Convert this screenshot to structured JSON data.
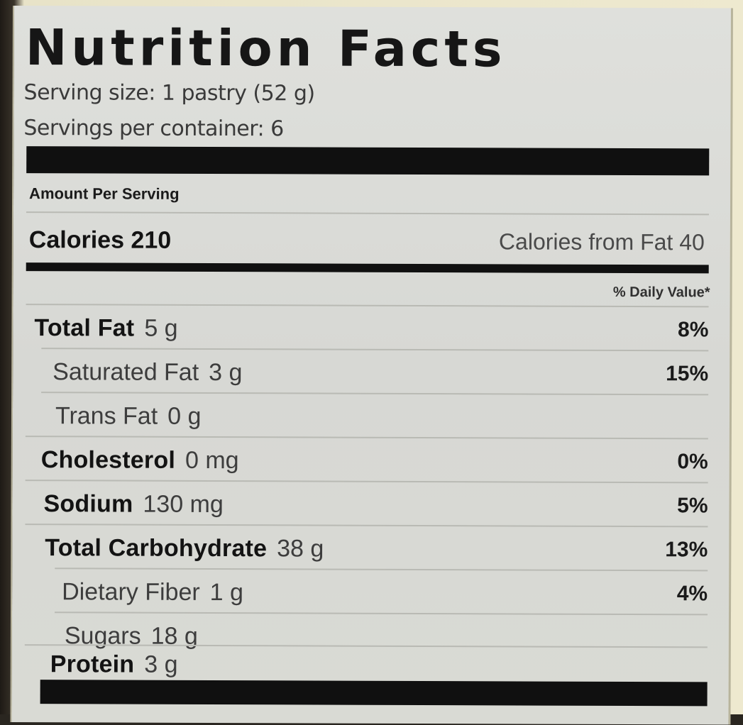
{
  "label": {
    "title": "Nutrition Facts",
    "serving_size": "Serving size: 1 pastry (52 g)",
    "servings_per_container": "Servings per container: 6",
    "amount_per_serving": "Amount Per Serving",
    "calories": "Calories 210",
    "calories_from_fat": "Calories from Fat 40",
    "daily_value_header": "% Daily Value*",
    "nutrients": [
      {
        "name": "Total Fat",
        "amount": "5 g",
        "dv": "8%"
      },
      {
        "name": "Saturated Fat",
        "amount": "3 g",
        "dv": "15%"
      },
      {
        "name": "Trans Fat",
        "amount": "0 g",
        "dv": ""
      },
      {
        "name": "Cholesterol",
        "amount": "0 mg",
        "dv": "0%"
      },
      {
        "name": "Sodium",
        "amount": "130 mg",
        "dv": "5%"
      },
      {
        "name": "Total Carbohydrate",
        "amount": "38 g",
        "dv": "13%"
      },
      {
        "name": "Dietary Fiber",
        "amount": "1 g",
        "dv": "4%"
      },
      {
        "name": "Sugars",
        "amount": "18 g",
        "dv": ""
      },
      {
        "name": "Protein",
        "amount": "3 g",
        "dv": ""
      }
    ]
  }
}
